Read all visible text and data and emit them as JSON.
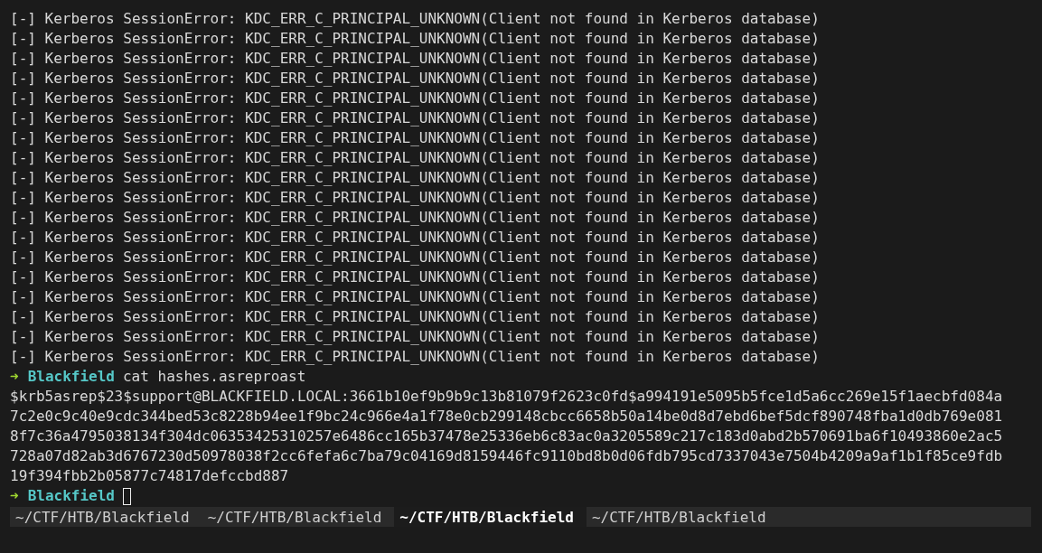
{
  "terminal": {
    "lines": [
      {
        "kind": "error",
        "marker": "[-]",
        "text": "Kerberos SessionError: KDC_ERR_C_PRINCIPAL_UNKNOWN(Client not found in Kerberos database)"
      },
      {
        "kind": "error",
        "marker": "[-]",
        "text": "Kerberos SessionError: KDC_ERR_C_PRINCIPAL_UNKNOWN(Client not found in Kerberos database)"
      },
      {
        "kind": "error",
        "marker": "[-]",
        "text": "Kerberos SessionError: KDC_ERR_C_PRINCIPAL_UNKNOWN(Client not found in Kerberos database)"
      },
      {
        "kind": "error",
        "marker": "[-]",
        "text": "Kerberos SessionError: KDC_ERR_C_PRINCIPAL_UNKNOWN(Client not found in Kerberos database)"
      },
      {
        "kind": "error",
        "marker": "[-]",
        "text": "Kerberos SessionError: KDC_ERR_C_PRINCIPAL_UNKNOWN(Client not found in Kerberos database)"
      },
      {
        "kind": "error",
        "marker": "[-]",
        "text": "Kerberos SessionError: KDC_ERR_C_PRINCIPAL_UNKNOWN(Client not found in Kerberos database)"
      },
      {
        "kind": "error",
        "marker": "[-]",
        "text": "Kerberos SessionError: KDC_ERR_C_PRINCIPAL_UNKNOWN(Client not found in Kerberos database)"
      },
      {
        "kind": "error",
        "marker": "[-]",
        "text": "Kerberos SessionError: KDC_ERR_C_PRINCIPAL_UNKNOWN(Client not found in Kerberos database)"
      },
      {
        "kind": "error",
        "marker": "[-]",
        "text": "Kerberos SessionError: KDC_ERR_C_PRINCIPAL_UNKNOWN(Client not found in Kerberos database)"
      },
      {
        "kind": "error",
        "marker": "[-]",
        "text": "Kerberos SessionError: KDC_ERR_C_PRINCIPAL_UNKNOWN(Client not found in Kerberos database)"
      },
      {
        "kind": "error",
        "marker": "[-]",
        "text": "Kerberos SessionError: KDC_ERR_C_PRINCIPAL_UNKNOWN(Client not found in Kerberos database)"
      },
      {
        "kind": "error",
        "marker": "[-]",
        "text": "Kerberos SessionError: KDC_ERR_C_PRINCIPAL_UNKNOWN(Client not found in Kerberos database)"
      },
      {
        "kind": "error",
        "marker": "[-]",
        "text": "Kerberos SessionError: KDC_ERR_C_PRINCIPAL_UNKNOWN(Client not found in Kerberos database)"
      },
      {
        "kind": "error",
        "marker": "[-]",
        "text": "Kerberos SessionError: KDC_ERR_C_PRINCIPAL_UNKNOWN(Client not found in Kerberos database)"
      },
      {
        "kind": "error",
        "marker": "[-]",
        "text": "Kerberos SessionError: KDC_ERR_C_PRINCIPAL_UNKNOWN(Client not found in Kerberos database)"
      },
      {
        "kind": "error",
        "marker": "[-]",
        "text": "Kerberos SessionError: KDC_ERR_C_PRINCIPAL_UNKNOWN(Client not found in Kerberos database)"
      },
      {
        "kind": "error",
        "marker": "[-]",
        "text": "Kerberos SessionError: KDC_ERR_C_PRINCIPAL_UNKNOWN(Client not found in Kerberos database)"
      },
      {
        "kind": "error",
        "marker": "[-]",
        "text": "Kerberos SessionError: KDC_ERR_C_PRINCIPAL_UNKNOWN(Client not found in Kerberos database)"
      },
      {
        "kind": "prompt",
        "arrow": "➜",
        "dir": "Blackfield",
        "command": "cat hashes.asreproast"
      },
      {
        "kind": "output",
        "text": "$krb5asrep$23$support@BLACKFIELD.LOCAL:3661b10ef9b9b9c13b81079f2623c0fd$a994191e5095b5fce1d5a6cc269e15f1aecbfd084a"
      },
      {
        "kind": "output",
        "text": "7c2e0c9c40e9cdc344bed53c8228b94ee1f9bc24c966e4a1f78e0cb299148cbcc6658b50a14be0d8d7ebd6bef5dcf890748fba1d0db769e081"
      },
      {
        "kind": "output",
        "text": "8f7c36a4795038134f304dc06353425310257e6486cc165b37478e25336eb6c83ac0a3205589c217c183d0abd2b570691ba6f10493860e2ac5"
      },
      {
        "kind": "output",
        "text": "728a07d82ab3d6767230d50978038f2cc6fefa6c7ba79c04169d8159446fc9110bd8b0d06fdb795cd7337043e7504b4209a9af1b1f85ce9fdb"
      },
      {
        "kind": "output",
        "text": "19f394fbb2b05877c74817defccbd887"
      },
      {
        "kind": "prompt",
        "arrow": "➜",
        "dir": "Blackfield",
        "cursor": true
      }
    ]
  },
  "tabs": [
    {
      "label": "~/CTF/HTB/Blackfield",
      "selected": false
    },
    {
      "label": "~/CTF/HTB/Blackfield",
      "selected": false
    },
    {
      "label": "~/CTF/HTB/Blackfield",
      "selected": true
    },
    {
      "label": "~/CTF/HTB/Blackfield",
      "selected": false
    }
  ]
}
